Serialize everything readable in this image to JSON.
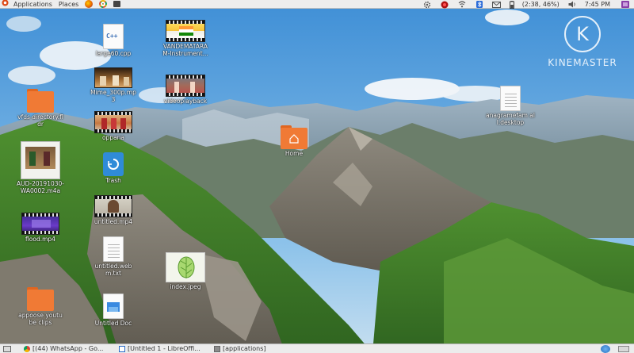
{
  "top_panel": {
    "applications_label": "Applications",
    "places_label": "Places",
    "battery_text": "(2:38, 46%)",
    "clock": "7:45 PM"
  },
  "desktop_icons": {
    "large60_cpp": "large60.cpp",
    "vandemataram": "VANDEMATARAM-Instrument...",
    "mime_300p": "Mime_300p.mp3",
    "videoplayback": "videoplayback",
    "vfds_directory": "vfds directory.fldr",
    "oppana": "oppana",
    "aud_file": "AUD-20191030-WA0002.m4a",
    "trash": "Trash",
    "untitled_mp4": "untitled.mp4",
    "flood_mp4": "flood.mp4",
    "untitled_webm": "untitled.webm.txt",
    "index_jpeg": "index.jpeg",
    "home": "Home",
    "anagramefam": "anagramefam all.desktop",
    "appoose": "appoose youtube clips",
    "untitled_doc": "Untitled Doc"
  },
  "watermark": {
    "brand": "KINEMASTER",
    "letter": "K"
  },
  "taskbar": {
    "whatsapp": "[(44) WhatsApp - Go...",
    "libreoffice": "[Untitled 1 - LibreOffi...",
    "applications": "[applications]"
  },
  "colors": {
    "panel": "#ededed",
    "folder": "#f07a35",
    "sky": "#5aa3dc",
    "grass": "#3f7d2a"
  }
}
